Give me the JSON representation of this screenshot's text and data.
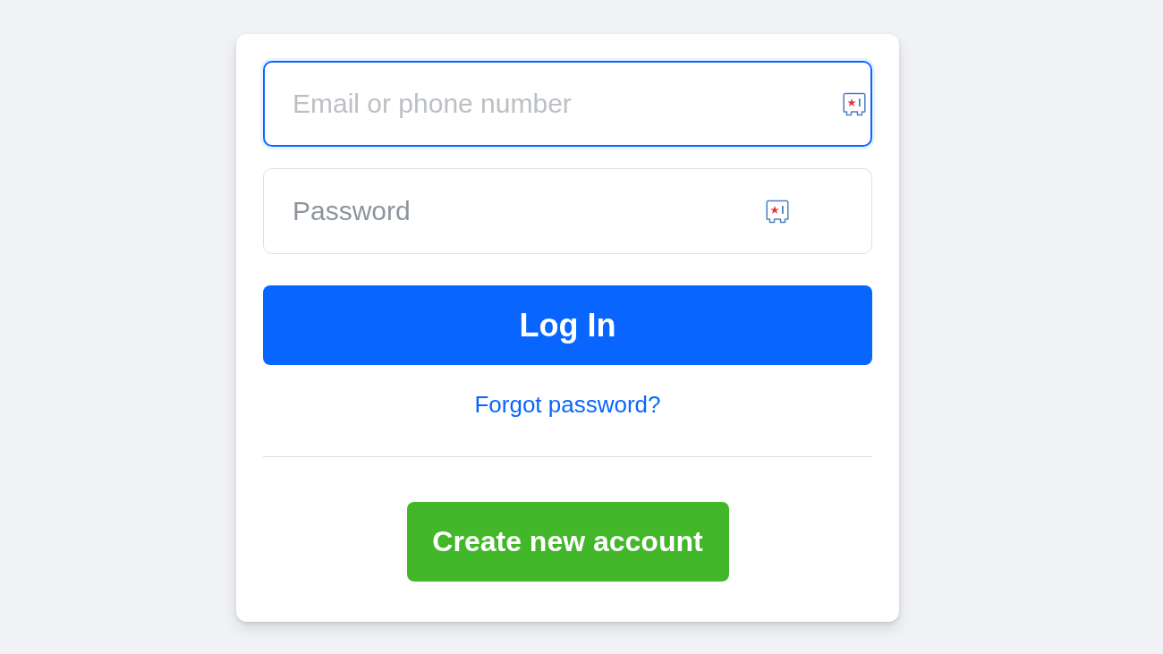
{
  "login_form": {
    "fields": [
      {
        "placeholder": "Email or phone number",
        "focused": true
      },
      {
        "placeholder": "Password",
        "focused": false
      }
    ],
    "login_button": {
      "label": "Log In"
    },
    "forgot_link": {
      "label": "Forgot password?"
    },
    "create_button": {
      "label": "Create new account"
    }
  }
}
